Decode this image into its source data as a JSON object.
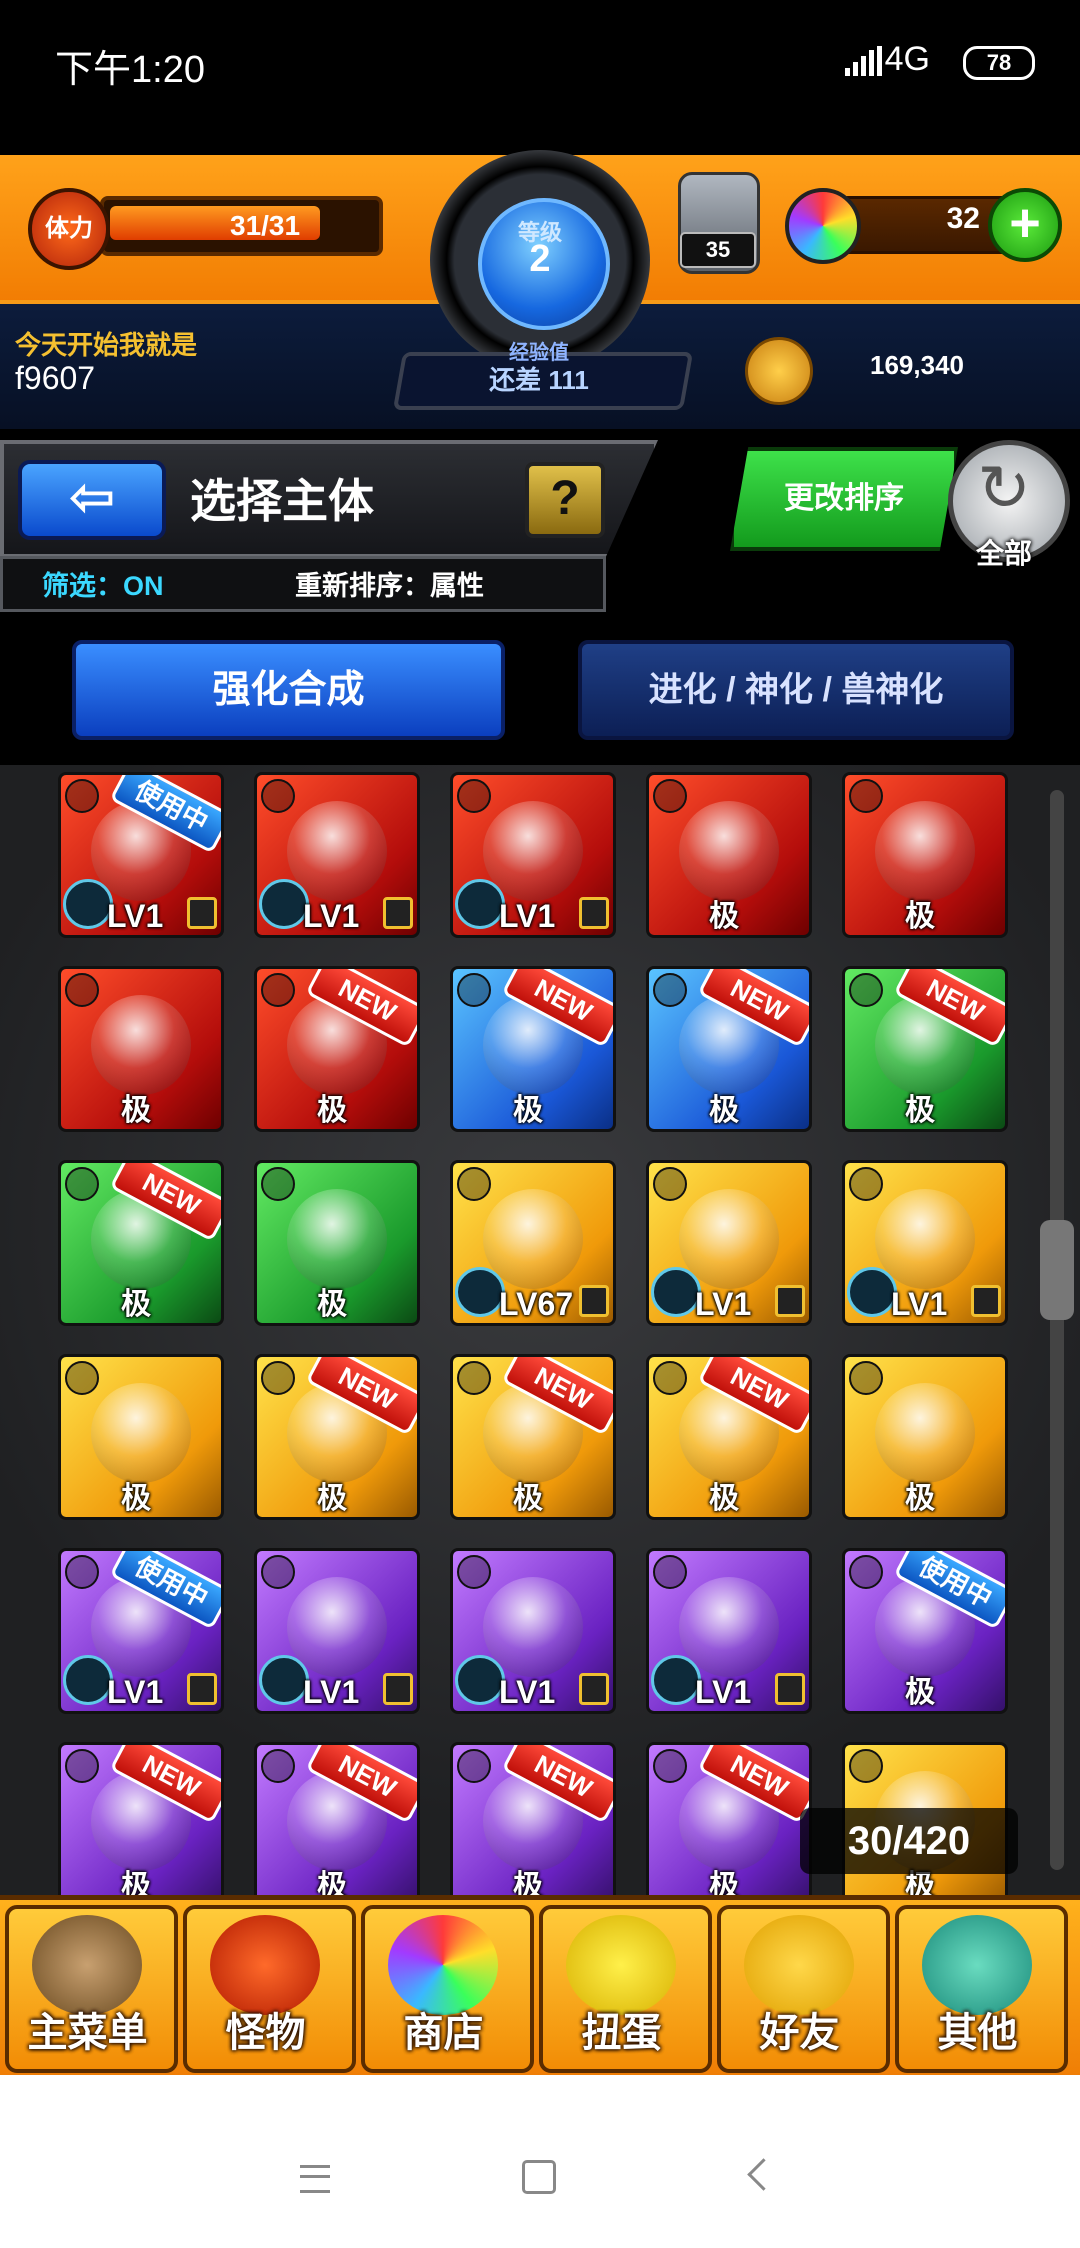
{
  "status_bar": {
    "time": "下午1:20",
    "network": "4G",
    "battery": "78"
  },
  "header": {
    "stamina_label": "体力",
    "stamina": "31/31",
    "rank_label": "等级",
    "rank": "2",
    "exp_label": "经验值",
    "exp_remaining": "还差 111",
    "orb_jar_count": "35",
    "orb_count": "32",
    "add_label": "+",
    "player_motto": "今天开始我就是",
    "player_name": "f9607",
    "gold": "169,340"
  },
  "title_row": {
    "back_icon": "arrow-left-icon",
    "title": "选择主体",
    "help": "?",
    "filter": "筛选：ON",
    "sort_status": "重新排序：属性",
    "sort_button": "更改排序",
    "all_button": "全部"
  },
  "tabs": [
    {
      "label": "强化合成",
      "active": true
    },
    {
      "label": "进化 / 神化 / 兽神化",
      "active": false
    }
  ],
  "monsters": [
    {
      "element": "fire",
      "badge": "使用中",
      "lv": "LV1",
      "locked": true,
      "max": ""
    },
    {
      "element": "fire",
      "badge": "",
      "lv": "LV1",
      "locked": true,
      "max": ""
    },
    {
      "element": "fire",
      "badge": "",
      "lv": "LV1",
      "locked": true,
      "max": ""
    },
    {
      "element": "fire",
      "badge": "",
      "lv": "",
      "locked": false,
      "max": "极"
    },
    {
      "element": "fire",
      "badge": "",
      "lv": "",
      "locked": false,
      "max": "极"
    },
    {
      "element": "fire",
      "badge": "",
      "lv": "",
      "locked": false,
      "max": "极"
    },
    {
      "element": "fire",
      "badge": "NEW",
      "lv": "",
      "locked": false,
      "max": "极"
    },
    {
      "element": "water",
      "badge": "NEW",
      "lv": "",
      "locked": false,
      "max": "极"
    },
    {
      "element": "water",
      "badge": "NEW",
      "lv": "",
      "locked": false,
      "max": "极"
    },
    {
      "element": "wood",
      "badge": "NEW",
      "lv": "",
      "locked": false,
      "max": "极"
    },
    {
      "element": "wood",
      "badge": "NEW",
      "lv": "",
      "locked": false,
      "max": "极"
    },
    {
      "element": "wood",
      "badge": "",
      "lv": "",
      "locked": false,
      "max": "极"
    },
    {
      "element": "light",
      "badge": "",
      "lv": "LV67",
      "locked": true,
      "max": ""
    },
    {
      "element": "light",
      "badge": "",
      "lv": "LV1",
      "locked": true,
      "max": ""
    },
    {
      "element": "light",
      "badge": "",
      "lv": "LV1",
      "locked": true,
      "max": ""
    },
    {
      "element": "light",
      "badge": "",
      "lv": "",
      "locked": false,
      "max": "极"
    },
    {
      "element": "light",
      "badge": "NEW",
      "lv": "",
      "locked": false,
      "max": "极"
    },
    {
      "element": "light",
      "badge": "NEW",
      "lv": "",
      "locked": false,
      "max": "极"
    },
    {
      "element": "light",
      "badge": "NEW",
      "lv": "",
      "locked": false,
      "max": "极"
    },
    {
      "element": "light",
      "badge": "",
      "lv": "",
      "locked": false,
      "max": "极"
    },
    {
      "element": "dark",
      "badge": "使用中",
      "lv": "LV1",
      "locked": true,
      "max": ""
    },
    {
      "element": "dark",
      "badge": "",
      "lv": "LV1",
      "locked": true,
      "max": ""
    },
    {
      "element": "dark",
      "badge": "",
      "lv": "LV1",
      "locked": true,
      "max": ""
    },
    {
      "element": "dark",
      "badge": "",
      "lv": "LV1",
      "locked": true,
      "max": ""
    },
    {
      "element": "dark",
      "badge": "使用中",
      "lv": "",
      "locked": false,
      "max": "极"
    },
    {
      "element": "dark",
      "badge": "NEW",
      "lv": "",
      "locked": false,
      "max": "极"
    },
    {
      "element": "dark",
      "badge": "NEW",
      "lv": "",
      "locked": false,
      "max": "极"
    },
    {
      "element": "dark",
      "badge": "NEW",
      "lv": "",
      "locked": false,
      "max": "极"
    },
    {
      "element": "dark",
      "badge": "NEW",
      "lv": "",
      "locked": false,
      "max": "极"
    },
    {
      "element": "light",
      "badge": "",
      "lv": "",
      "locked": false,
      "max": "极"
    }
  ],
  "box_count": "30/420",
  "nav": [
    {
      "label": "主菜单",
      "icon": "gate-icon"
    },
    {
      "label": "怪物",
      "icon": "dragon-icon"
    },
    {
      "label": "商店",
      "icon": "rainbow-orb-icon"
    },
    {
      "label": "扭蛋",
      "icon": "egg-icon"
    },
    {
      "label": "好友",
      "icon": "balloons-icon"
    },
    {
      "label": "其他",
      "icon": "question-sign-icon"
    }
  ]
}
